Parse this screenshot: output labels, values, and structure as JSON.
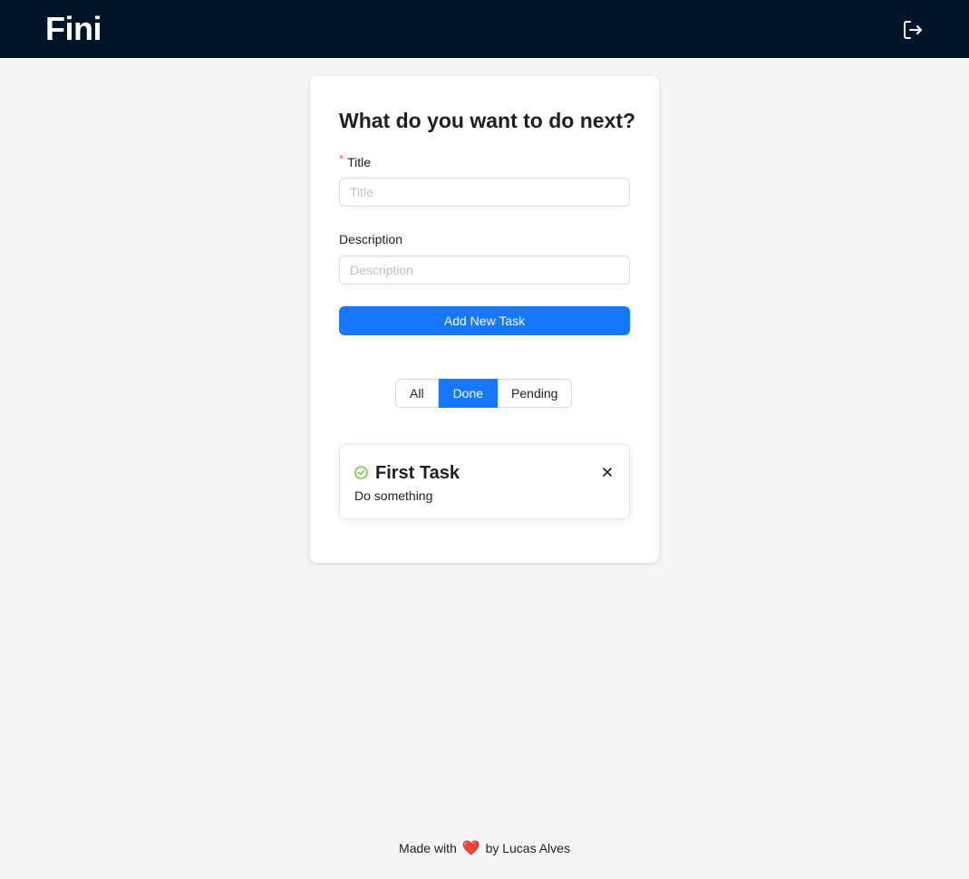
{
  "app": {
    "logo": "Fini"
  },
  "header": {
    "logout_icon": "logout-icon"
  },
  "form": {
    "heading": "What do you want to do next?",
    "title_label": "Title",
    "title_required_mark": "*",
    "title_placeholder": "Title",
    "title_value": "",
    "description_label": "Description",
    "description_placeholder": "Description",
    "description_value": "",
    "submit_label": "Add New Task"
  },
  "filter": {
    "options": [
      "All",
      "Done",
      "Pending"
    ],
    "selected": "Done"
  },
  "tasks": [
    {
      "title": "First Task",
      "description": "Do something",
      "status_icon": "check-circle-icon",
      "done": true
    }
  ],
  "footer": {
    "prefix": "Made with",
    "heart": "❤️",
    "suffix": "by Lucas Alves"
  },
  "colors": {
    "header_bg": "#001529",
    "primary": "#1677ff",
    "success": "#52c41a",
    "required": "#ff4d4f",
    "page_bg": "#f5f5f5"
  }
}
